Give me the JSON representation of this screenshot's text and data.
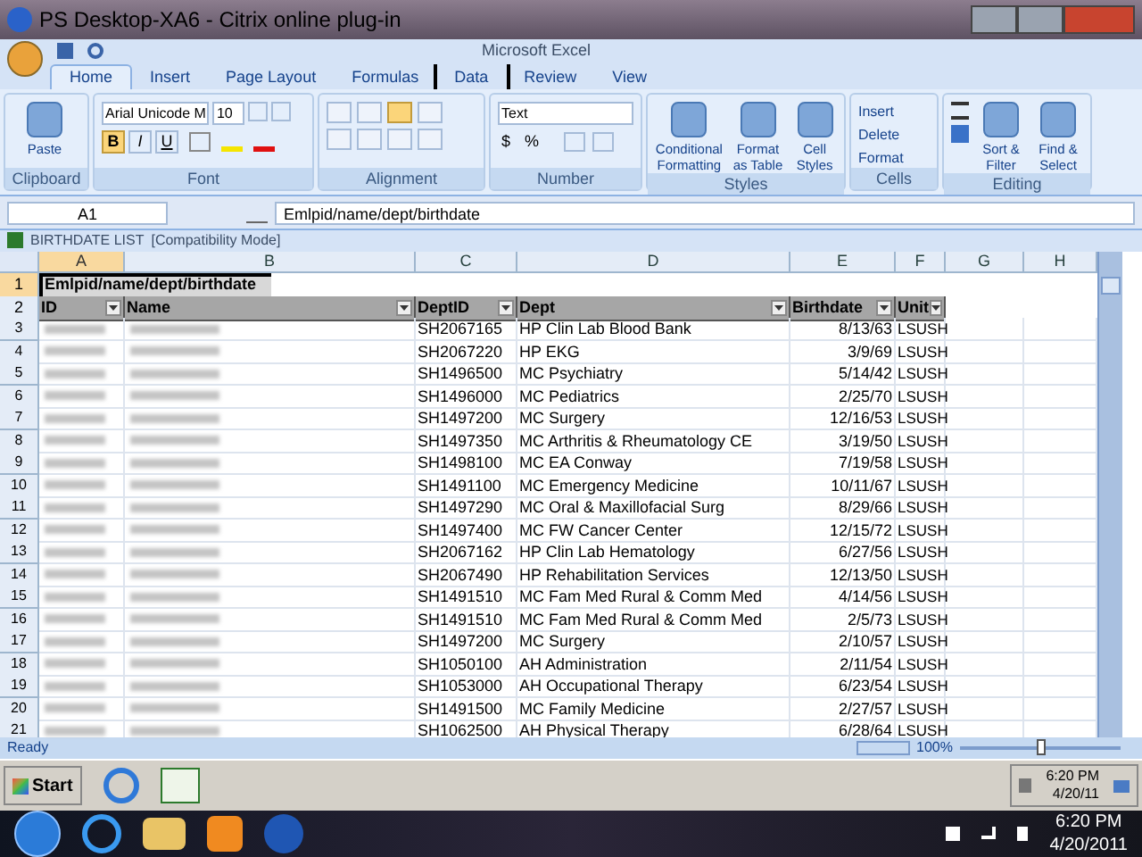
{
  "window": {
    "title": "PS Desktop-XA6 - Citrix online plug-in"
  },
  "excel": {
    "title": "Microsoft Excel"
  },
  "tabs": [
    {
      "label": "Home",
      "selected": true,
      "outlined": false
    },
    {
      "label": "Insert",
      "selected": false,
      "outlined": false
    },
    {
      "label": "Page Layout",
      "selected": false,
      "outlined": false
    },
    {
      "label": "Formulas",
      "selected": false,
      "outlined": false
    },
    {
      "label": "Data",
      "selected": false,
      "outlined": true
    },
    {
      "label": "Review",
      "selected": false,
      "outlined": false
    },
    {
      "label": "View",
      "selected": false,
      "outlined": false
    }
  ],
  "ribbon": {
    "clipboard": {
      "paste": "Paste",
      "label": "Clipboard"
    },
    "font": {
      "family": "Arial Unicode M",
      "size": "10",
      "label": "Font",
      "buttons": [
        {
          "label": "B",
          "on": true
        },
        {
          "label": "I",
          "on": false
        },
        {
          "label": "U",
          "on": false
        }
      ]
    },
    "alignment": {
      "label": "Alignment"
    },
    "number": {
      "format": "Text",
      "currency": "$",
      "percent": "%",
      "label": "Number"
    },
    "styles": {
      "items": [
        "Conditional Formatting",
        "Format as Table",
        "Cell Styles"
      ],
      "label": "Styles"
    },
    "cells": {
      "items": [
        "Insert",
        "Delete",
        "Format"
      ],
      "label": "Cells"
    },
    "editing": {
      "items": [
        "Sort & Filter",
        "Find & Select"
      ],
      "label": "Editing"
    }
  },
  "formula_bar": {
    "name_box": "A1",
    "value": "Emlpid/name/dept/birthdate"
  },
  "workbook": {
    "title": "BIRTHDATE LIST",
    "mode": "[Compatibility Mode]"
  },
  "columns": [
    {
      "label": "A",
      "selected": true
    },
    {
      "label": "B",
      "selected": false
    },
    {
      "label": "C",
      "selected": false
    },
    {
      "label": "D",
      "selected": false
    },
    {
      "label": "E",
      "selected": false
    },
    {
      "label": "F",
      "selected": false
    },
    {
      "label": "G",
      "selected": false
    },
    {
      "label": "H",
      "selected": false
    }
  ],
  "title_row": {
    "row": "1",
    "selected": true,
    "cell": "Emlpid/name/dept/birthdate"
  },
  "header_row": {
    "row": "2",
    "headers": [
      "ID",
      "Name",
      "DeptID",
      "Dept",
      "Birthdate",
      "Unit"
    ]
  },
  "rows": [
    {
      "row": "3",
      "dept_id": "SH2067165",
      "dept": "HP Clin Lab Blood Bank",
      "birthdate": "8/13/63",
      "unit": "LSUSH"
    },
    {
      "row": "4",
      "dept_id": "SH2067220",
      "dept": "HP EKG",
      "birthdate": "3/9/69",
      "unit": "LSUSH"
    },
    {
      "row": "5",
      "dept_id": "SH1496500",
      "dept": "MC Psychiatry",
      "birthdate": "5/14/42",
      "unit": "LSUSH"
    },
    {
      "row": "6",
      "dept_id": "SH1496000",
      "dept": "MC Pediatrics",
      "birthdate": "2/25/70",
      "unit": "LSUSH"
    },
    {
      "row": "7",
      "dept_id": "SH1497200",
      "dept": "MC Surgery",
      "birthdate": "12/16/53",
      "unit": "LSUSH"
    },
    {
      "row": "8",
      "dept_id": "SH1497350",
      "dept": "MC Arthritis & Rheumatology CE",
      "birthdate": "3/19/50",
      "unit": "LSUSH"
    },
    {
      "row": "9",
      "dept_id": "SH1498100",
      "dept": "MC EA Conway",
      "birthdate": "7/19/58",
      "unit": "LSUSH"
    },
    {
      "row": "10",
      "dept_id": "SH1491100",
      "dept": "MC Emergency Medicine",
      "birthdate": "10/11/67",
      "unit": "LSUSH"
    },
    {
      "row": "11",
      "dept_id": "SH1497290",
      "dept": "MC Oral & Maxillofacial Surg",
      "birthdate": "8/29/66",
      "unit": "LSUSH"
    },
    {
      "row": "12",
      "dept_id": "SH1497400",
      "dept": "MC FW Cancer Center",
      "birthdate": "12/15/72",
      "unit": "LSUSH"
    },
    {
      "row": "13",
      "dept_id": "SH2067162",
      "dept": "HP Clin Lab Hematology",
      "birthdate": "6/27/56",
      "unit": "LSUSH"
    },
    {
      "row": "14",
      "dept_id": "SH2067490",
      "dept": "HP Rehabilitation Services",
      "birthdate": "12/13/50",
      "unit": "LSUSH"
    },
    {
      "row": "15",
      "dept_id": "SH1491510",
      "dept": "MC Fam Med Rural & Comm Med",
      "birthdate": "4/14/56",
      "unit": "LSUSH"
    },
    {
      "row": "16",
      "dept_id": "SH1491510",
      "dept": "MC Fam Med Rural & Comm Med",
      "birthdate": "2/5/73",
      "unit": "LSUSH"
    },
    {
      "row": "17",
      "dept_id": "SH1497200",
      "dept": "MC Surgery",
      "birthdate": "2/10/57",
      "unit": "LSUSH"
    },
    {
      "row": "18",
      "dept_id": "SH1050100",
      "dept": "AH Administration",
      "birthdate": "2/11/54",
      "unit": "LSUSH"
    },
    {
      "row": "19",
      "dept_id": "SH1053000",
      "dept": "AH Occupational Therapy",
      "birthdate": "6/23/54",
      "unit": "LSUSH"
    },
    {
      "row": "20",
      "dept_id": "SH1491500",
      "dept": "MC Family Medicine",
      "birthdate": "2/27/57",
      "unit": "LSUSH"
    },
    {
      "row": "21",
      "dept_id": "SH1062500",
      "dept": "AH Physical Therapy",
      "birthdate": "6/28/64",
      "unit": "LSUSH"
    }
  ],
  "status_bar": {
    "status": "Ready",
    "zoom": "100%",
    "level": 0.5
  },
  "citrix_taskbar": {
    "start": "Start",
    "time": "6:20 PM",
    "date": "4/20/11"
  },
  "windows_taskbar": {
    "time": "6:20 PM",
    "date": "4/20/2011"
  }
}
